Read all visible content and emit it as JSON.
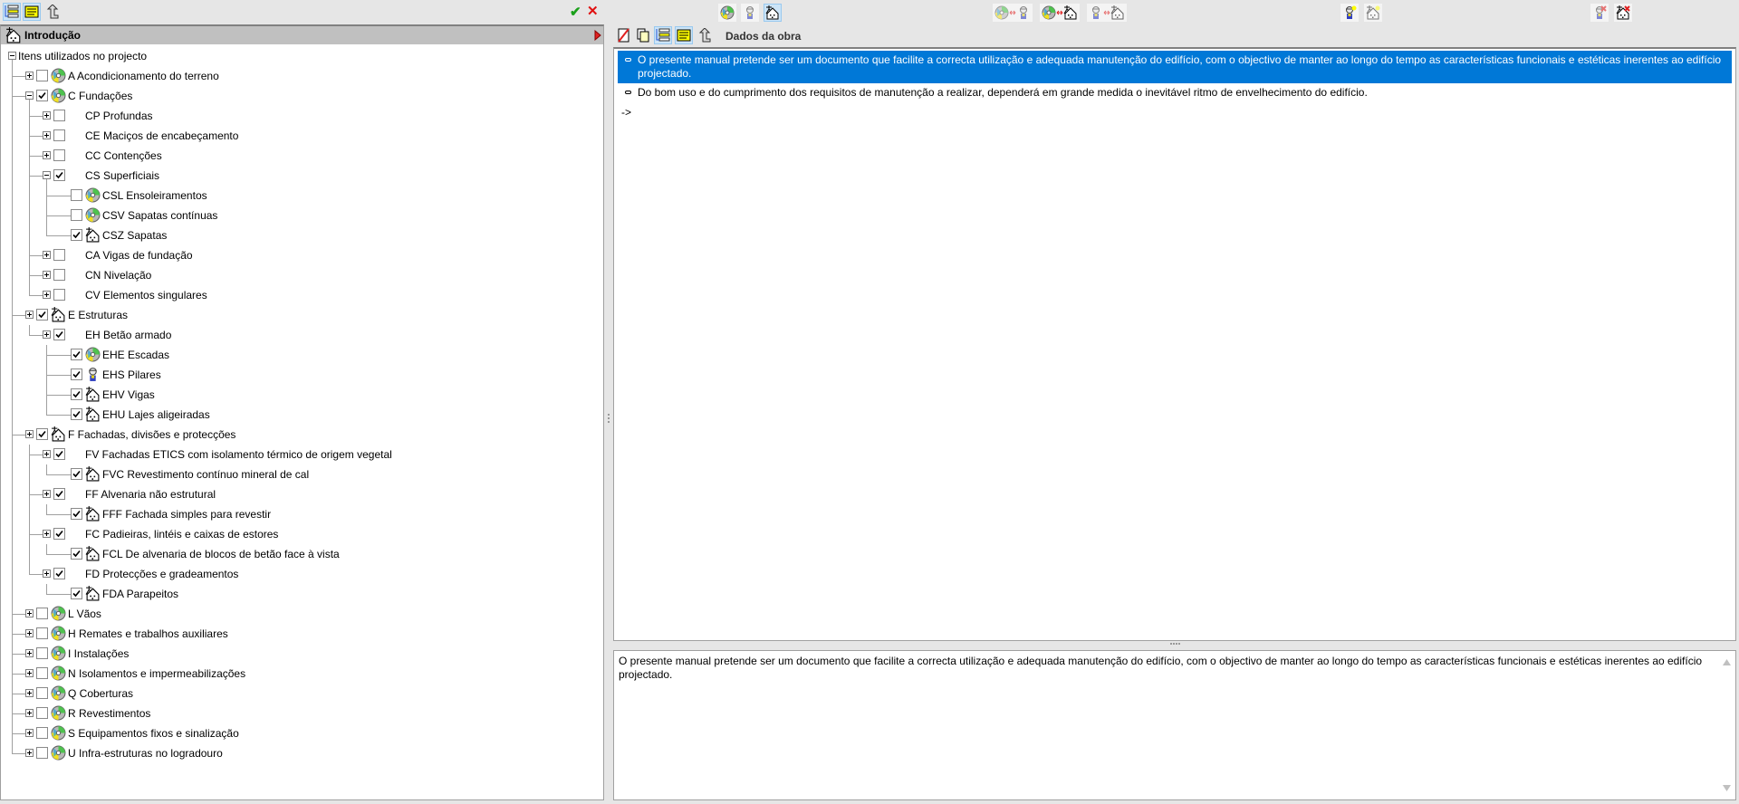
{
  "left_toolbar": {
    "buttons": [
      "tree-view",
      "list-view",
      "go-up"
    ],
    "accept_label": "✔",
    "cancel_label": "✕"
  },
  "intro": {
    "label": "Introdução"
  },
  "tree": [
    {
      "level": 0,
      "exp": "minus",
      "chk": null,
      "icon": "none",
      "label": "Itens utilizados no projecto"
    },
    {
      "level": 1,
      "exp": "plus",
      "chk": false,
      "icon": "disc",
      "label": "A Acondicionamento do terreno"
    },
    {
      "level": 1,
      "exp": "minus",
      "chk": true,
      "icon": "disc",
      "label": "C Fundações"
    },
    {
      "level": 2,
      "exp": "plus",
      "chk": false,
      "icon": "none",
      "label": "CP Profundas"
    },
    {
      "level": 2,
      "exp": "plus",
      "chk": false,
      "icon": "none",
      "label": "CE Maciços de encabeçamento"
    },
    {
      "level": 2,
      "exp": "plus",
      "chk": false,
      "icon": "none",
      "label": "CC Contenções"
    },
    {
      "level": 2,
      "exp": "minus",
      "chk": true,
      "icon": "none",
      "label": "CS Superficiais"
    },
    {
      "level": 3,
      "exp": null,
      "chk": false,
      "icon": "disc",
      "label": "CSL Ensoleiramentos"
    },
    {
      "level": 3,
      "exp": null,
      "chk": false,
      "icon": "disc",
      "label": "CSV Sapatas contínuas"
    },
    {
      "level": 3,
      "exp": null,
      "chk": true,
      "icon": "house",
      "label": "CSZ Sapatas"
    },
    {
      "level": 2,
      "exp": "plus",
      "chk": false,
      "icon": "none",
      "label": "CA Vigas de fundação"
    },
    {
      "level": 2,
      "exp": "plus",
      "chk": false,
      "icon": "none",
      "label": "CN Nivelação"
    },
    {
      "level": 2,
      "exp": "plus",
      "chk": false,
      "icon": "none",
      "label": "CV Elementos singulares"
    },
    {
      "level": 1,
      "exp": "plus",
      "chk": true,
      "icon": "house",
      "label": "E Estruturas"
    },
    {
      "level": 2,
      "exp": "plus",
      "chk": true,
      "icon": "none",
      "label": "EH Betão armado"
    },
    {
      "level": 3,
      "exp": null,
      "chk": true,
      "icon": "disc",
      "label": "EHE Escadas"
    },
    {
      "level": 3,
      "exp": null,
      "chk": true,
      "icon": "worker",
      "label": "EHS Pilares"
    },
    {
      "level": 3,
      "exp": null,
      "chk": true,
      "icon": "house",
      "label": "EHV Vigas"
    },
    {
      "level": 3,
      "exp": null,
      "chk": true,
      "icon": "house",
      "label": "EHU Lajes aligeiradas"
    },
    {
      "level": 1,
      "exp": "plus",
      "chk": true,
      "icon": "house",
      "label": "F Fachadas, divisões e protecções"
    },
    {
      "level": 2,
      "exp": "plus",
      "chk": true,
      "icon": "none",
      "label": "FV Fachadas ETICS com isolamento térmico de origem vegetal"
    },
    {
      "level": 3,
      "exp": null,
      "chk": true,
      "icon": "house",
      "label": "FVC Revestimento contínuo mineral de cal"
    },
    {
      "level": 2,
      "exp": "plus",
      "chk": true,
      "icon": "none",
      "label": "FF Alvenaria não estrutural"
    },
    {
      "level": 3,
      "exp": null,
      "chk": true,
      "icon": "house",
      "label": "FFF Fachada simples para revestir"
    },
    {
      "level": 2,
      "exp": "plus",
      "chk": true,
      "icon": "none",
      "label": "FC Padieiras, lintéis e caixas de estores"
    },
    {
      "level": 3,
      "exp": null,
      "chk": true,
      "icon": "house",
      "label": "FCL De alvenaria de blocos de betão face à vista"
    },
    {
      "level": 2,
      "exp": "plus",
      "chk": true,
      "icon": "none",
      "label": "FD Protecções e gradeamentos"
    },
    {
      "level": 3,
      "exp": null,
      "chk": true,
      "icon": "house",
      "label": "FDA Parapeitos"
    },
    {
      "level": 1,
      "exp": "plus",
      "chk": false,
      "icon": "disc",
      "label": "L Vãos"
    },
    {
      "level": 1,
      "exp": "plus",
      "chk": false,
      "icon": "disc",
      "label": "H Remates e trabalhos auxiliares"
    },
    {
      "level": 1,
      "exp": "plus",
      "chk": false,
      "icon": "disc",
      "label": "I Instalações"
    },
    {
      "level": 1,
      "exp": "plus",
      "chk": false,
      "icon": "disc",
      "label": "N Isolamentos e impermeabilizações"
    },
    {
      "level": 1,
      "exp": "plus",
      "chk": false,
      "icon": "disc",
      "label": "Q Coberturas"
    },
    {
      "level": 1,
      "exp": "plus",
      "chk": false,
      "icon": "disc",
      "label": "R Revestimentos"
    },
    {
      "level": 1,
      "exp": "plus",
      "chk": false,
      "icon": "disc",
      "label": "S Equipamentos fixos e sinalização"
    },
    {
      "level": 1,
      "exp": "plus",
      "chk": false,
      "icon": "disc",
      "label": "U Infra-estruturas no logradouro"
    }
  ],
  "right_toolbar": {
    "title": "Dados da obra"
  },
  "list": {
    "items": [
      {
        "text": "O presente manual pretende ser um documento que facilite a correcta utilização e adequada manutenção do edifício, com o objectivo de manter ao longo do tempo as características funcionais e estéticas inerentes ao edifício projectado.",
        "selected": true
      },
      {
        "text": "Do bom uso e do cumprimento dos requisitos de manutenção a realizar, dependerá em grande medida o inevitável ritmo de envelhecimento do edifício.",
        "selected": false
      }
    ],
    "new_item": "->"
  },
  "detail_text": "O presente manual pretende ser um documento que facilite a correcta utilização e adequada manutenção do edifício, com o objectivo de manter ao longo do tempo as características funcionais e estéticas inerentes ao edifício projectado.",
  "colors": {
    "selection": "#0078d7",
    "accept": "#1aa01a",
    "cancel": "#e01010",
    "arrow": "#e02020"
  }
}
